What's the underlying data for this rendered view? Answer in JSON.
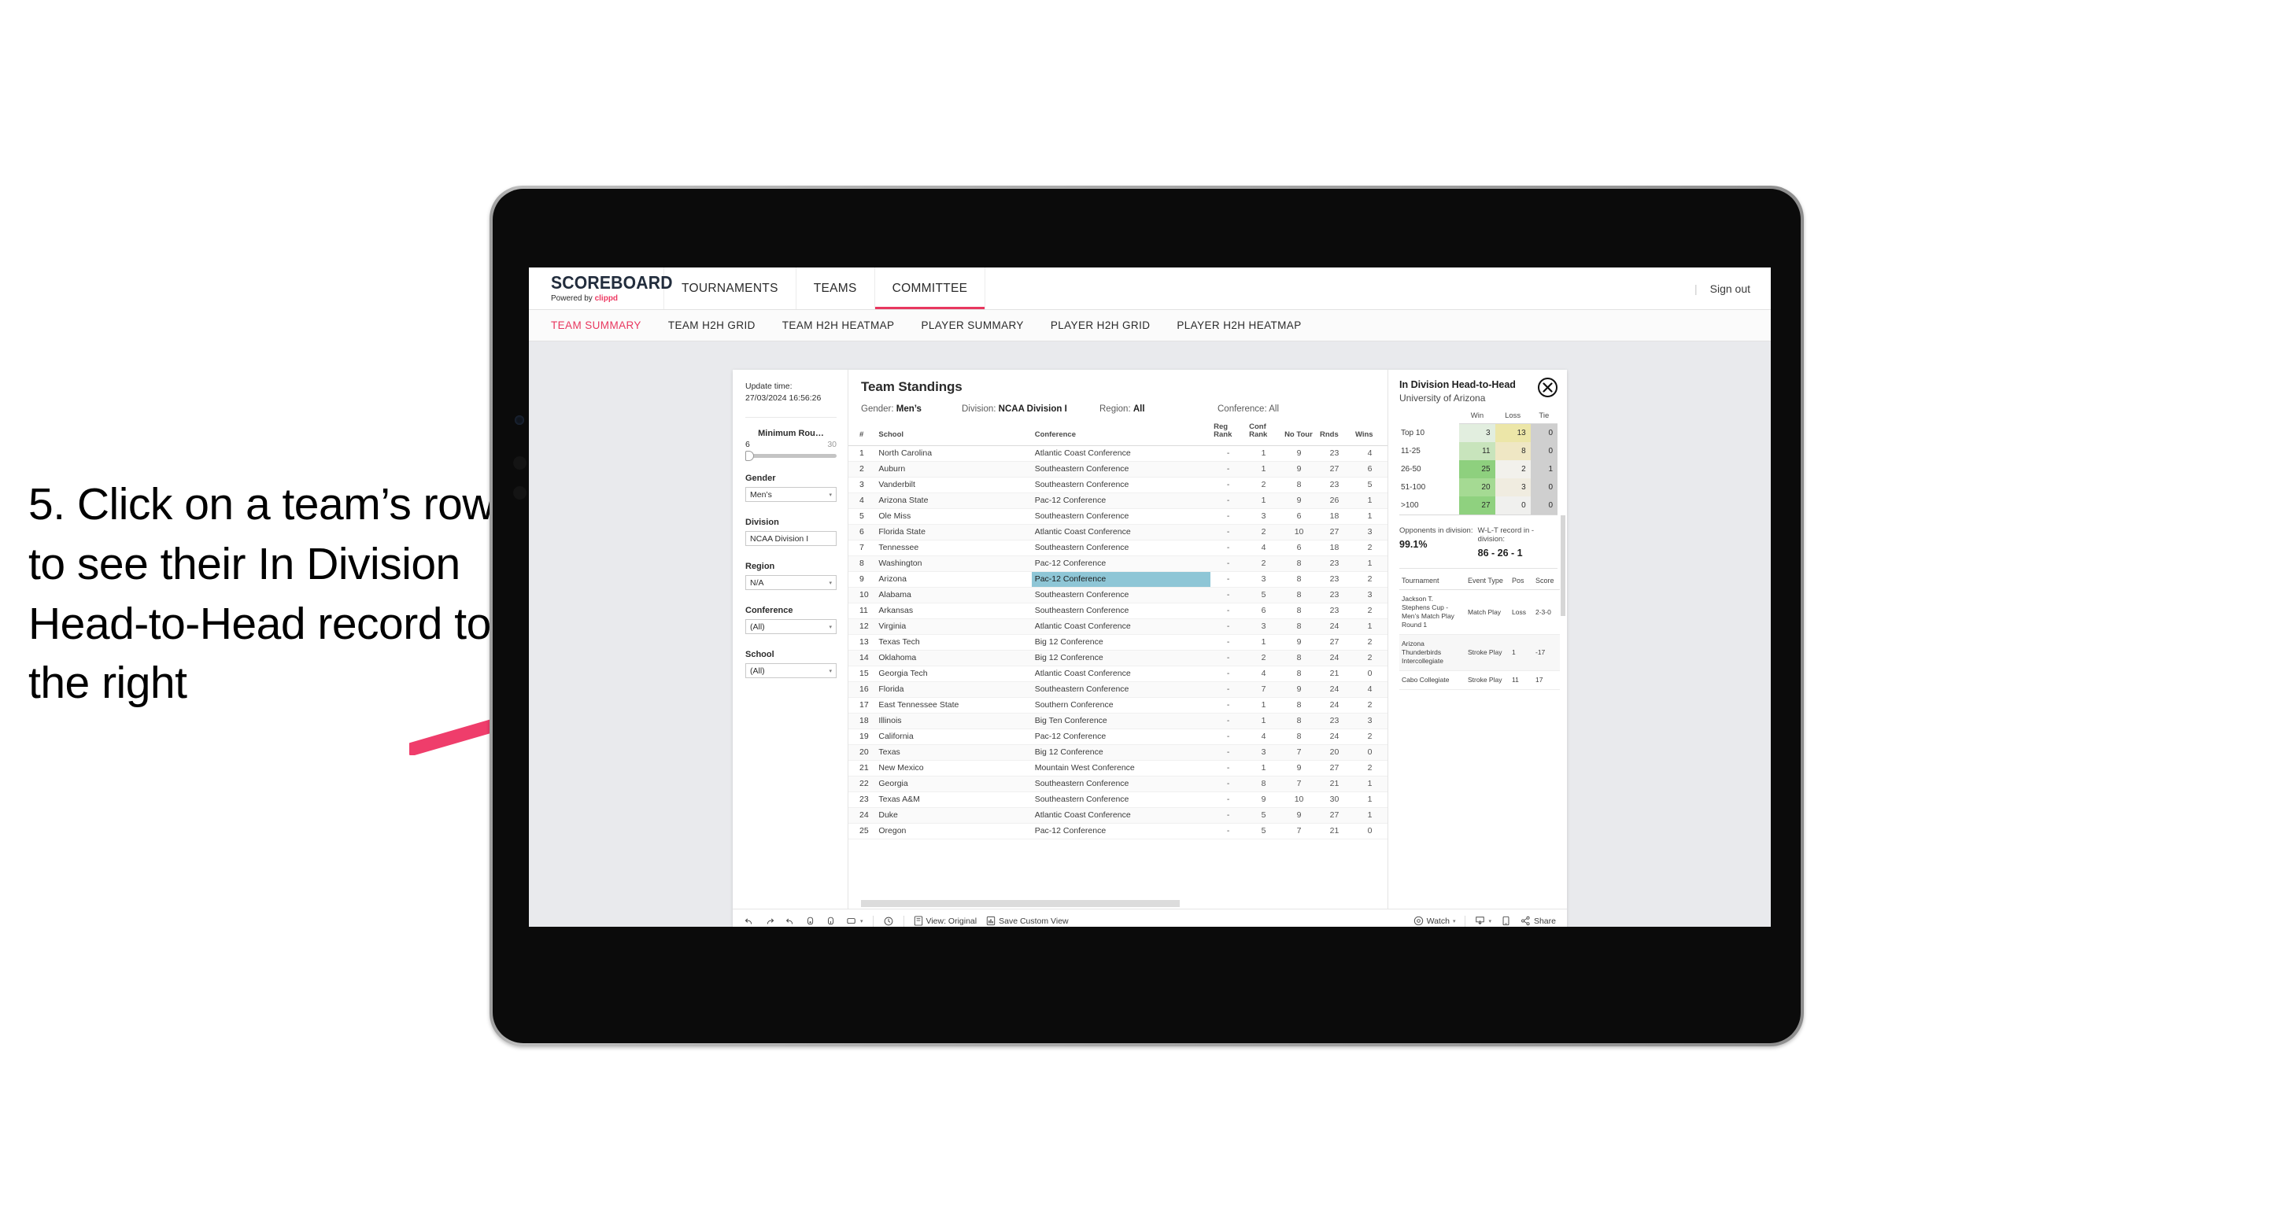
{
  "instruction": "5. Click on a team’s row to see their In Division Head-to-Head record to the right",
  "accent": "#e8375f",
  "highlight": "#8ec6d6",
  "topnav": {
    "logo": "SCOREBOARD",
    "logo_sub_prefix": "Powered by ",
    "logo_sub_brand": "clippd",
    "items": [
      {
        "label": "TOURNAMENTS",
        "active": false
      },
      {
        "label": "TEAMS",
        "active": false
      },
      {
        "label": "COMMITTEE",
        "active": true
      }
    ],
    "signout": "Sign out",
    "divider": "|"
  },
  "subnav": {
    "items": [
      {
        "label": "TEAM SUMMARY",
        "active": true
      },
      {
        "label": "TEAM H2H GRID",
        "active": false
      },
      {
        "label": "TEAM H2H HEATMAP",
        "active": false
      },
      {
        "label": "PLAYER SUMMARY",
        "active": false
      },
      {
        "label": "PLAYER H2H GRID",
        "active": false
      },
      {
        "label": "PLAYER H2H HEATMAP",
        "active": false
      }
    ]
  },
  "filters": {
    "update_label": "Update time:",
    "update_value": "27/03/2024 16:56:26",
    "slider": {
      "label": "Minimum Rou…",
      "min": "6",
      "max": "30"
    },
    "groups": [
      {
        "label": "Gender",
        "value": "Men’s",
        "caret": "▾"
      },
      {
        "label": "Division",
        "value": "NCAA Division I",
        "caret": ""
      },
      {
        "label": "Region",
        "value": "N/A",
        "caret": "▾"
      },
      {
        "label": "Conference",
        "value": "(All)",
        "caret": "▾"
      },
      {
        "label": "School",
        "value": "(All)",
        "caret": "▾"
      }
    ]
  },
  "standings": {
    "title": "Team Standings",
    "meta": [
      {
        "label": "Gender:",
        "value": "Men’s"
      },
      {
        "label": "Division:",
        "value": "NCAA Division I"
      },
      {
        "label": "Region:",
        "value": "All"
      },
      {
        "label": "Conference:",
        "value": "All"
      }
    ],
    "columns": [
      "#",
      "School",
      "Conference",
      "Reg Rank",
      "Conf Rank",
      "No Tour",
      "Rnds",
      "Wins"
    ],
    "rows": [
      {
        "rank": "1",
        "school": "North Carolina",
        "conf": "Atlantic Coast Conference",
        "reg": "-",
        "cr": "1",
        "nt": "9",
        "rnds": "23",
        "wins": "4",
        "hl": false
      },
      {
        "rank": "2",
        "school": "Auburn",
        "conf": "Southeastern Conference",
        "reg": "-",
        "cr": "1",
        "nt": "9",
        "rnds": "27",
        "wins": "6",
        "hl": false
      },
      {
        "rank": "3",
        "school": "Vanderbilt",
        "conf": "Southeastern Conference",
        "reg": "-",
        "cr": "2",
        "nt": "8",
        "rnds": "23",
        "wins": "5",
        "hl": false
      },
      {
        "rank": "4",
        "school": "Arizona State",
        "conf": "Pac-12 Conference",
        "reg": "-",
        "cr": "1",
        "nt": "9",
        "rnds": "26",
        "wins": "1",
        "hl": false
      },
      {
        "rank": "5",
        "school": "Ole Miss",
        "conf": "Southeastern Conference",
        "reg": "-",
        "cr": "3",
        "nt": "6",
        "rnds": "18",
        "wins": "1",
        "hl": false
      },
      {
        "rank": "6",
        "school": "Florida State",
        "conf": "Atlantic Coast Conference",
        "reg": "-",
        "cr": "2",
        "nt": "10",
        "rnds": "27",
        "wins": "3",
        "hl": false
      },
      {
        "rank": "7",
        "school": "Tennessee",
        "conf": "Southeastern Conference",
        "reg": "-",
        "cr": "4",
        "nt": "6",
        "rnds": "18",
        "wins": "2",
        "hl": false
      },
      {
        "rank": "8",
        "school": "Washington",
        "conf": "Pac-12 Conference",
        "reg": "-",
        "cr": "2",
        "nt": "8",
        "rnds": "23",
        "wins": "1",
        "hl": false
      },
      {
        "rank": "9",
        "school": "Arizona",
        "conf": "Pac-12 Conference",
        "reg": "-",
        "cr": "3",
        "nt": "8",
        "rnds": "23",
        "wins": "2",
        "hl": true
      },
      {
        "rank": "10",
        "school": "Alabama",
        "conf": "Southeastern Conference",
        "reg": "-",
        "cr": "5",
        "nt": "8",
        "rnds": "23",
        "wins": "3",
        "hl": false
      },
      {
        "rank": "11",
        "school": "Arkansas",
        "conf": "Southeastern Conference",
        "reg": "-",
        "cr": "6",
        "nt": "8",
        "rnds": "23",
        "wins": "2",
        "hl": false
      },
      {
        "rank": "12",
        "school": "Virginia",
        "conf": "Atlantic Coast Conference",
        "reg": "-",
        "cr": "3",
        "nt": "8",
        "rnds": "24",
        "wins": "1",
        "hl": false
      },
      {
        "rank": "13",
        "school": "Texas Tech",
        "conf": "Big 12 Conference",
        "reg": "-",
        "cr": "1",
        "nt": "9",
        "rnds": "27",
        "wins": "2",
        "hl": false
      },
      {
        "rank": "14",
        "school": "Oklahoma",
        "conf": "Big 12 Conference",
        "reg": "-",
        "cr": "2",
        "nt": "8",
        "rnds": "24",
        "wins": "2",
        "hl": false
      },
      {
        "rank": "15",
        "school": "Georgia Tech",
        "conf": "Atlantic Coast Conference",
        "reg": "-",
        "cr": "4",
        "nt": "8",
        "rnds": "21",
        "wins": "0",
        "hl": false
      },
      {
        "rank": "16",
        "school": "Florida",
        "conf": "Southeastern Conference",
        "reg": "-",
        "cr": "7",
        "nt": "9",
        "rnds": "24",
        "wins": "4",
        "hl": false
      },
      {
        "rank": "17",
        "school": "East Tennessee State",
        "conf": "Southern Conference",
        "reg": "-",
        "cr": "1",
        "nt": "8",
        "rnds": "24",
        "wins": "2",
        "hl": false
      },
      {
        "rank": "18",
        "school": "Illinois",
        "conf": "Big Ten Conference",
        "reg": "-",
        "cr": "1",
        "nt": "8",
        "rnds": "23",
        "wins": "3",
        "hl": false
      },
      {
        "rank": "19",
        "school": "California",
        "conf": "Pac-12 Conference",
        "reg": "-",
        "cr": "4",
        "nt": "8",
        "rnds": "24",
        "wins": "2",
        "hl": false
      },
      {
        "rank": "20",
        "school": "Texas",
        "conf": "Big 12 Conference",
        "reg": "-",
        "cr": "3",
        "nt": "7",
        "rnds": "20",
        "wins": "0",
        "hl": false
      },
      {
        "rank": "21",
        "school": "New Mexico",
        "conf": "Mountain West Conference",
        "reg": "-",
        "cr": "1",
        "nt": "9",
        "rnds": "27",
        "wins": "2",
        "hl": false
      },
      {
        "rank": "22",
        "school": "Georgia",
        "conf": "Southeastern Conference",
        "reg": "-",
        "cr": "8",
        "nt": "7",
        "rnds": "21",
        "wins": "1",
        "hl": false
      },
      {
        "rank": "23",
        "school": "Texas A&M",
        "conf": "Southeastern Conference",
        "reg": "-",
        "cr": "9",
        "nt": "10",
        "rnds": "30",
        "wins": "1",
        "hl": false
      },
      {
        "rank": "24",
        "school": "Duke",
        "conf": "Atlantic Coast Conference",
        "reg": "-",
        "cr": "5",
        "nt": "9",
        "rnds": "27",
        "wins": "1",
        "hl": false
      },
      {
        "rank": "25",
        "school": "Oregon",
        "conf": "Pac-12 Conference",
        "reg": "-",
        "cr": "5",
        "nt": "7",
        "rnds": "21",
        "wins": "0",
        "hl": false
      }
    ]
  },
  "h2h": {
    "title": "In Division Head-to-Head",
    "subtitle": "University of Arizona",
    "close_icon": "close-icon",
    "columns": [
      "",
      "Win",
      "Loss",
      "Tie"
    ],
    "rows": [
      {
        "band": "Top 10",
        "win": "3",
        "loss": "13",
        "tie": "0",
        "win_bg": "#e2eedf",
        "loss_bg": "#ece6a8",
        "tie_bg": "#cfcfcf"
      },
      {
        "band": "11-25",
        "win": "11",
        "loss": "8",
        "tie": "0",
        "win_bg": "#c8e4bc",
        "loss_bg": "#efe7c4",
        "tie_bg": "#cfcfcf"
      },
      {
        "band": "26-50",
        "win": "25",
        "loss": "2",
        "tie": "1",
        "win_bg": "#8ed07e",
        "loss_bg": "#f2f1ec",
        "tie_bg": "#cfcfcf"
      },
      {
        "band": "51-100",
        "win": "20",
        "loss": "3",
        "tie": "0",
        "win_bg": "#a5da93",
        "loss_bg": "#f0ece0",
        "tie_bg": "#cfcfcf"
      },
      {
        "band": ">100",
        "win": "27",
        "loss": "0",
        "tie": "0",
        "win_bg": "#8fd17f",
        "loss_bg": "#f0f0ee",
        "tie_bg": "#cfcfcf"
      }
    ],
    "stats": [
      {
        "label": "Opponents in division:",
        "value": "99.1%"
      },
      {
        "label": "W-L-T record in -division:",
        "value": "86 - 26 - 1"
      }
    ],
    "tournament_columns": [
      "Tournament",
      "Event Type",
      "Pos",
      "Score"
    ],
    "tournaments": [
      {
        "name": "Jackson T. Stephens Cup - Men’s Match Play Round 1",
        "type": "Match Play",
        "pos": "Loss",
        "score": "2-3-0"
      },
      {
        "name": "Arizona Thunderbirds Intercollegiate",
        "type": "Stroke Play",
        "pos": "1",
        "score": "-17"
      },
      {
        "name": "Cabo Collegiate",
        "type": "Stroke Play",
        "pos": "11",
        "score": "17"
      }
    ]
  },
  "toolbar": {
    "view_label": "View: Original",
    "save_label": "Save Custom View",
    "watch_label": "Watch",
    "share_label": "Share",
    "caret": "▾"
  }
}
